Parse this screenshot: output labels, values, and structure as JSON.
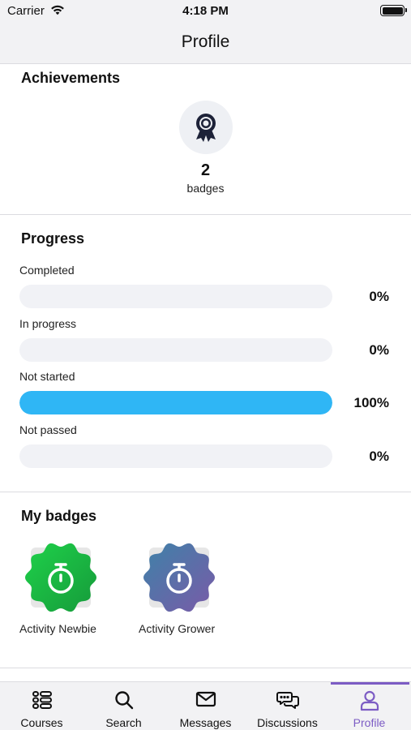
{
  "status_bar": {
    "carrier": "Carrier",
    "time": "4:18 PM"
  },
  "nav": {
    "title": "Profile"
  },
  "achievements": {
    "title": "Achievements",
    "icon": "award-ribbon-icon",
    "count": "2",
    "count_label": "badges"
  },
  "progress": {
    "title": "Progress",
    "items": [
      {
        "label": "Completed",
        "percent_text": "0%",
        "value": 0
      },
      {
        "label": "In progress",
        "percent_text": "0%",
        "value": 0
      },
      {
        "label": "Not started",
        "percent_text": "100%",
        "value": 100
      },
      {
        "label": "Not passed",
        "percent_text": "0%",
        "value": 0
      }
    ],
    "fill_color": "#2fb6f5",
    "track_color": "#f1f2f6"
  },
  "my_badges": {
    "title": "My badges",
    "items": [
      {
        "name": "Activity Newbie",
        "icon": "stopwatch-icon",
        "colors": [
          "#1fd14a",
          "#159a3a"
        ]
      },
      {
        "name": "Activity Grower",
        "icon": "stopwatch-icon",
        "colors": [
          "#3e82a8",
          "#7a5aa8"
        ]
      }
    ]
  },
  "tab_bar": {
    "active": "profile",
    "accent": "#7c5cc4",
    "tabs": [
      {
        "label": "Courses",
        "icon": "courses-list-icon"
      },
      {
        "label": "Search",
        "icon": "search-icon"
      },
      {
        "label": "Messages",
        "icon": "envelope-icon"
      },
      {
        "label": "Discussions",
        "icon": "chat-bubbles-icon"
      },
      {
        "label": "Profile",
        "icon": "person-icon"
      }
    ]
  }
}
